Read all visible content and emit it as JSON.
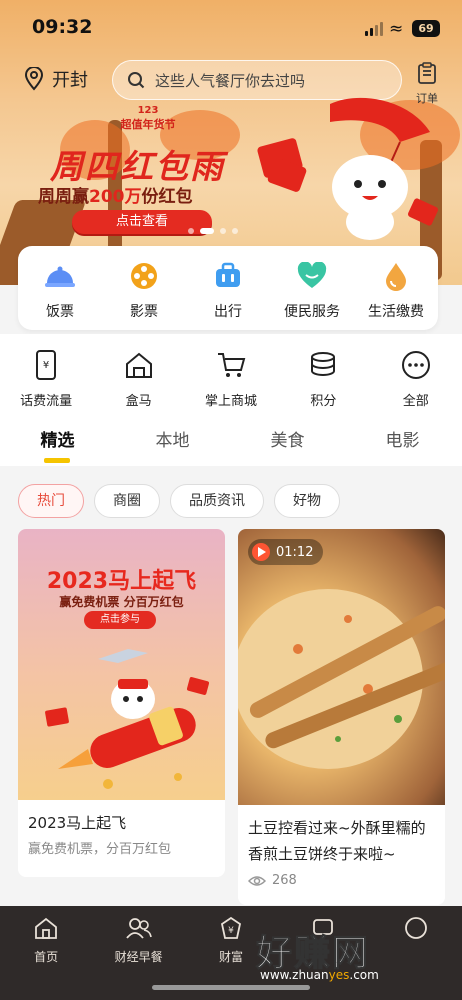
{
  "status_bar": {
    "time": "09:32",
    "battery": "69"
  },
  "header": {
    "city": "开封",
    "search_placeholder": "这些人气餐厅你去过吗",
    "orders_label": "订单"
  },
  "banner": {
    "badge_number": "123",
    "badge_text": "超值年货节",
    "title": "周四红包雨",
    "subtitle_prefix": "周周赢",
    "subtitle_highlight": "200万",
    "subtitle_suffix": "份红包",
    "button": "点击查看",
    "carousel_active_index": 1
  },
  "services": [
    {
      "label": "饭票",
      "icon": "food-cloche-icon",
      "color": "#5b8ef5"
    },
    {
      "label": "影票",
      "icon": "film-reel-icon",
      "color": "#f2a21a"
    },
    {
      "label": "出行",
      "icon": "suitcase-icon",
      "color": "#3f9df0"
    },
    {
      "label": "便民服务",
      "icon": "heart-service-icon",
      "color": "#39c5a3"
    },
    {
      "label": "生活缴费",
      "icon": "water-drop-icon",
      "color": "#f2a640"
    }
  ],
  "entries": [
    {
      "label": "话费流量",
      "icon": "phone-bill-icon"
    },
    {
      "label": "盒马",
      "icon": "hema-house-icon"
    },
    {
      "label": "掌上商城",
      "icon": "shopping-cart-icon"
    },
    {
      "label": "积分",
      "icon": "coins-stack-icon"
    },
    {
      "label": "全部",
      "icon": "more-dots-icon"
    }
  ],
  "tabs": [
    "精选",
    "本地",
    "美食",
    "电影"
  ],
  "chips": [
    "热门",
    "商圈",
    "品质资讯",
    "好物"
  ],
  "cards": [
    {
      "ad_title": "2023马上起飞",
      "ad_sub": "赢免费机票 分百万红包",
      "ad_button": "点击参与",
      "title": "2023马上起飞",
      "subtitle": "赢免费机票，分百万红包"
    },
    {
      "duration": "01:12",
      "title": "土豆控看过来~外酥里糯的香煎土豆饼终于来啦~",
      "views": "268"
    }
  ],
  "bottom_nav": [
    {
      "label": "首页",
      "icon": "home-icon"
    },
    {
      "label": "财经早餐",
      "icon": "people-icon"
    },
    {
      "label": "财富",
      "icon": "wealth-icon"
    },
    {
      "label": "",
      "icon": "community-icon"
    },
    {
      "label": "",
      "icon": "mine-icon"
    }
  ],
  "watermark": {
    "text": "好赚网",
    "url_prefix": "www.zhuan",
    "url_highlight": "yes",
    "url_suffix": ".com"
  }
}
